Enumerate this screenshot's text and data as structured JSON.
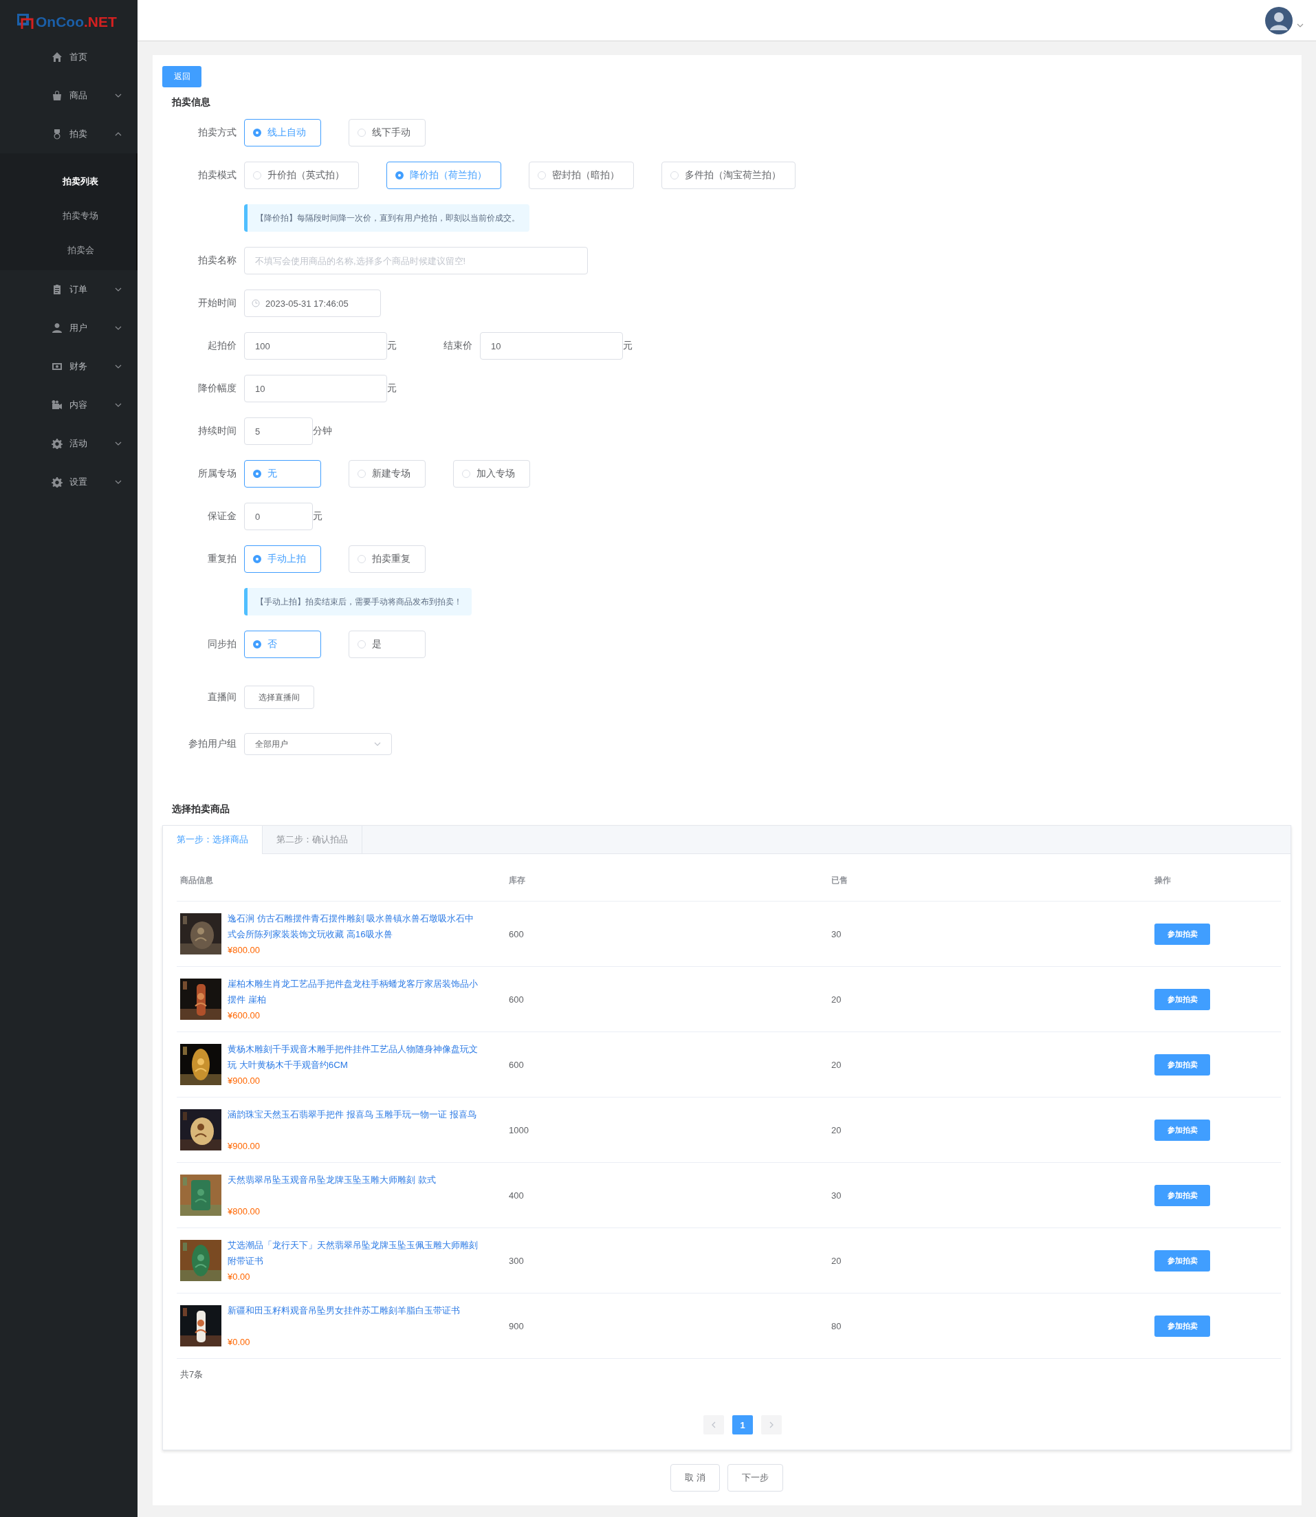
{
  "sidebar": {
    "logo": {
      "text": "OnCoo",
      "suffix": ".NET"
    },
    "items": [
      {
        "kind": "link",
        "label": "首页"
      },
      {
        "kind": "menu",
        "label": "商品",
        "expanded": false
      },
      {
        "kind": "menu",
        "label": "拍卖",
        "expanded": true,
        "children": [
          {
            "label": "拍卖列表",
            "selected": true
          },
          {
            "label": "拍卖专场",
            "selected": false
          },
          {
            "label": "拍卖会",
            "selected": false
          }
        ]
      },
      {
        "kind": "menu",
        "label": "订单",
        "expanded": false
      },
      {
        "kind": "menu",
        "label": "用户",
        "expanded": false
      },
      {
        "kind": "menu",
        "label": "财务",
        "expanded": false
      },
      {
        "kind": "menu",
        "label": "内容",
        "expanded": false
      },
      {
        "kind": "menu",
        "label": "活动",
        "expanded": false
      },
      {
        "kind": "menu",
        "label": "设置",
        "expanded": false
      }
    ]
  },
  "back_button": "返回",
  "form": {
    "title": "拍卖信息",
    "rows": [
      {
        "kind": "radio",
        "label": "拍卖方式",
        "options": [
          {
            "label": "线上自动",
            "selected": true
          },
          {
            "label": "线下手动",
            "selected": false
          }
        ]
      },
      {
        "kind": "radio",
        "label": "拍卖模式",
        "options": [
          {
            "label": "升价拍（英式拍）",
            "selected": false
          },
          {
            "label": "降价拍（荷兰拍）",
            "selected": true
          },
          {
            "label": "密封拍（暗拍）",
            "selected": false
          },
          {
            "label": "多件拍（淘宝荷兰拍）",
            "selected": false
          }
        ]
      },
      {
        "kind": "tip",
        "text": "【降价拍】每隔段时间降一次价，直到有用户抢拍，即刻以当前价成交。"
      },
      {
        "kind": "fields",
        "label": "拍卖名称",
        "fields": [
          {
            "kind": "text",
            "placeholder": "不填写会使用商品的名称,选择多个商品时候建议留空!"
          }
        ]
      },
      {
        "kind": "fields",
        "label": "开始时间",
        "fields": [
          {
            "kind": "date",
            "value": "2023-05-31 17:46:05"
          }
        ]
      },
      {
        "kind": "fields",
        "label": "起拍价",
        "fields": [
          {
            "kind": "amount",
            "value": "100",
            "unit": "元"
          },
          {
            "kind": "amount",
            "label": "结束价",
            "value": "10",
            "unit": "元"
          }
        ]
      },
      {
        "kind": "fields",
        "label": "降价幅度",
        "fields": [
          {
            "kind": "amount",
            "value": "10",
            "unit": "元"
          }
        ]
      },
      {
        "kind": "fields",
        "label": "持续时间",
        "fields": [
          {
            "kind": "short",
            "value": "5",
            "unit": "分钟"
          }
        ]
      },
      {
        "kind": "radio",
        "label": "所属专场",
        "options": [
          {
            "label": "无",
            "selected": true
          },
          {
            "label": "新建专场",
            "selected": false
          },
          {
            "label": "加入专场",
            "selected": false
          }
        ]
      },
      {
        "kind": "fields",
        "label": "保证金",
        "fields": [
          {
            "kind": "short",
            "value": "0",
            "unit": "元"
          }
        ]
      },
      {
        "kind": "radio",
        "label": "重复拍",
        "options": [
          {
            "label": "手动上拍",
            "selected": true
          },
          {
            "label": "拍卖重复",
            "selected": false
          }
        ]
      },
      {
        "kind": "tip",
        "text": "【手动上拍】拍卖结束后，需要手动将商品发布到拍卖！"
      },
      {
        "kind": "radio",
        "label": "同步拍",
        "options": [
          {
            "label": "否",
            "selected": true
          },
          {
            "label": "是",
            "selected": false
          }
        ]
      },
      {
        "kind": "fields",
        "label": "直播间",
        "fields": [
          {
            "kind": "picker",
            "value": "选择直播间"
          }
        ]
      },
      {
        "kind": "fields",
        "label": "参拍用户组",
        "fields": [
          {
            "kind": "select",
            "value": "全部用户"
          }
        ]
      }
    ]
  },
  "products": {
    "title": "选择拍卖商品",
    "steps": [
      {
        "label": "第一步：选择商品",
        "selected": true
      },
      {
        "label": "第二步：确认拍品",
        "selected": false
      }
    ],
    "columns": [
      "商品信息",
      "库存",
      "已售",
      "操作"
    ],
    "rows": [
      {
        "title": "逸石涧 仿古石雕摆件青石摆件雕刻 吸水兽镇水兽石墩吸水石中式会所陈列家装装饰文玩收藏 高16吸水兽",
        "price": "¥800.00",
        "stock": "600",
        "sold": "30",
        "action": "参加拍卖"
      },
      {
        "title": "崖柏木雕生肖龙工艺品手把件盘龙柱手柄蟠龙客厅家居装饰品小摆件 崖柏",
        "price": "¥600.00",
        "stock": "600",
        "sold": "20",
        "action": "参加拍卖"
      },
      {
        "title": "黄杨木雕刻千手观音木雕手把件挂件工艺品人物随身神像盘玩文玩 大叶黄杨木千手观音约6CM",
        "price": "¥900.00",
        "stock": "600",
        "sold": "20",
        "action": "参加拍卖"
      },
      {
        "title": "涵韵珠宝天然玉石翡翠手把件 报喜鸟 玉雕手玩一物一证 报喜鸟",
        "price": "¥900.00",
        "stock": "1000",
        "sold": "20",
        "action": "参加拍卖"
      },
      {
        "title": "天然翡翠吊坠玉观音吊坠龙牌玉坠玉雕大师雕刻 款式",
        "price": "¥800.00",
        "stock": "400",
        "sold": "30",
        "action": "参加拍卖"
      },
      {
        "title": "艾选潮品「龙行天下」天然翡翠吊坠龙牌玉坠玉佩玉雕大师雕刻附带证书",
        "price": "¥0.00",
        "stock": "300",
        "sold": "20",
        "action": "参加拍卖"
      },
      {
        "title": "新疆和田玉籽料观音吊坠男女挂件苏工雕刻羊脂白玉带证书",
        "price": "¥0.00",
        "stock": "900",
        "sold": "80",
        "action": "参加拍卖"
      }
    ],
    "total": "共7条",
    "pages": [
      {
        "label": "1",
        "selected": true
      }
    ]
  },
  "footer_buttons": [
    "取 消",
    "下一步"
  ]
}
